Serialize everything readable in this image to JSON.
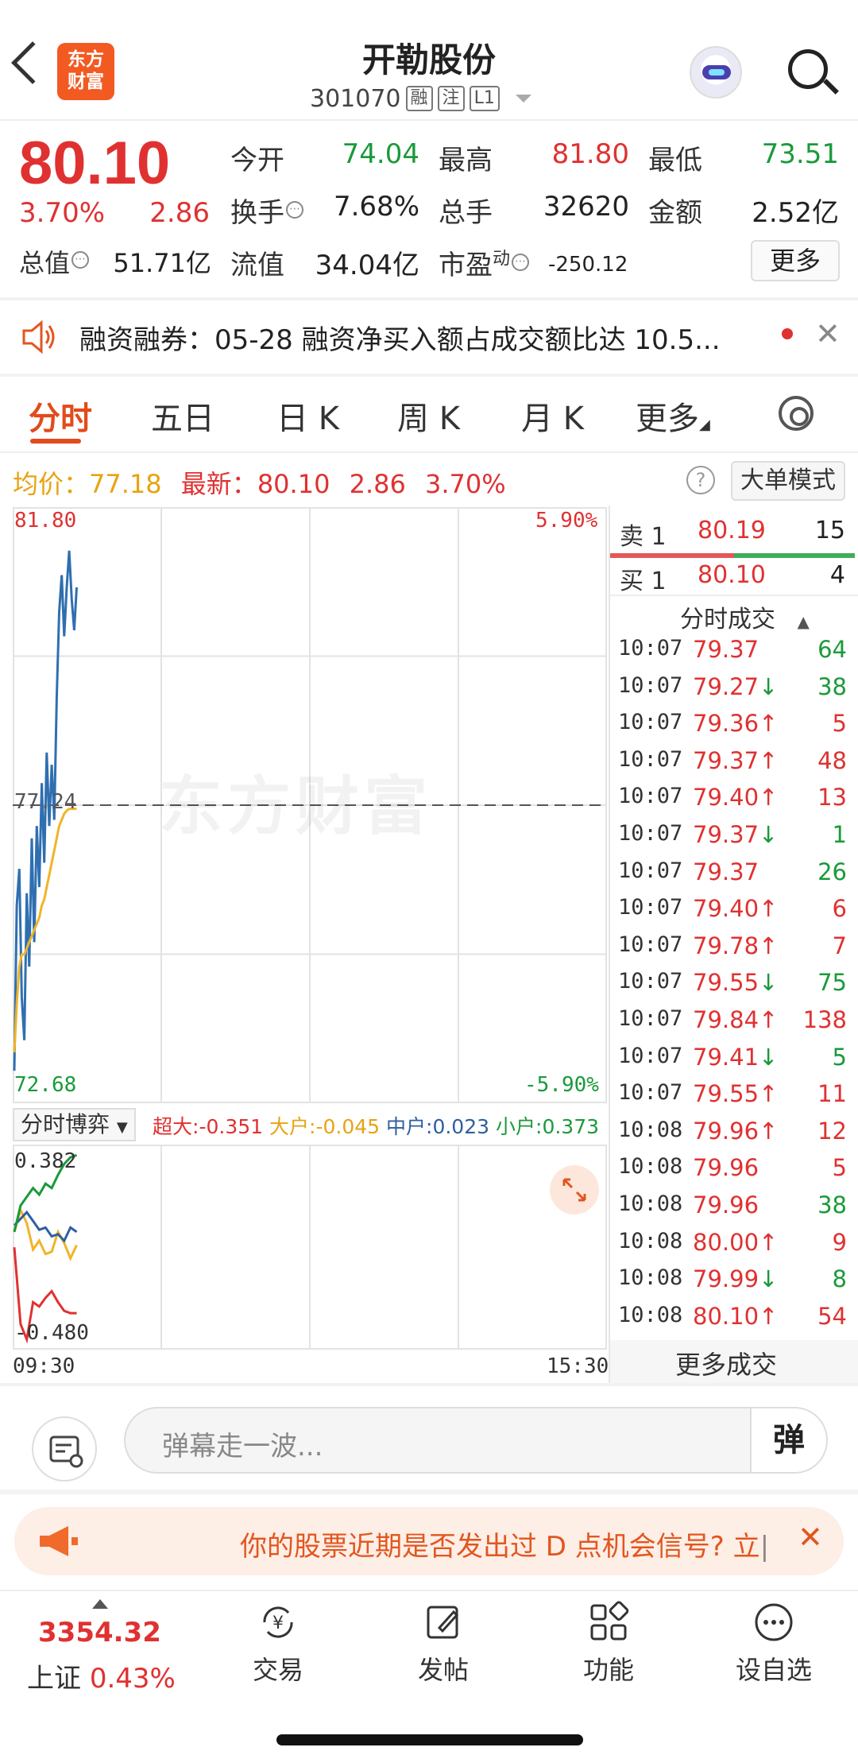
{
  "header": {
    "logo_line1": "东方",
    "logo_line2": "财富",
    "title": "开勒股份",
    "code": "301070",
    "tags": [
      "融",
      "注",
      "L1"
    ]
  },
  "quote": {
    "price": "80.10",
    "change_pct": "3.70%",
    "change": "2.86",
    "open_label": "今开",
    "open": "74.04",
    "high_label": "最高",
    "high": "81.80",
    "low_label": "最低",
    "low": "73.51",
    "turnover_label": "换手",
    "turnover": "7.68%",
    "volume_label": "总手",
    "volume": "32620",
    "amount_label": "金额",
    "amount": "2.52亿",
    "mktcap_label": "总值",
    "mktcap": "51.71亿",
    "float_label": "流值",
    "float": "34.04亿",
    "pe_label": "市盈",
    "pe_sup": "动",
    "pe": "-250.12",
    "more": "更多"
  },
  "notice": {
    "text": "融资融券：05-28 融资净买入额占成交额比达 10.5..."
  },
  "tabs": [
    "分时",
    "五日",
    "日 K",
    "周 K",
    "月 K",
    "更多"
  ],
  "info_row": {
    "avg_label": "均价：",
    "avg": "77.18",
    "latest_label": "最新：",
    "latest": "80.10",
    "change": "2.86",
    "change_pct": "3.70%",
    "help": "?",
    "big_order": "大单模式"
  },
  "chart_data": [
    {
      "type": "line",
      "x_start": "09:30",
      "x_end": "15:30",
      "ylim": [
        72.68,
        81.8
      ],
      "y_mid": "77.24",
      "right_top": "5.90%",
      "right_bottom": "-5.90%",
      "series": [
        {
          "name": "最新",
          "color": "#2f6fb0",
          "values": [
            72.9,
            75.6,
            76.2,
            74.1,
            73.4,
            75.8,
            74.6,
            76.7,
            75.0,
            76.9,
            75.9,
            77.6,
            76.3,
            78.1,
            76.9,
            77.9,
            77.0,
            79.0,
            80.4,
            81.0,
            80.0,
            80.8,
            81.4,
            80.6,
            80.1,
            80.8
          ]
        },
        {
          "name": "均价",
          "color": "#f0b429",
          "values": [
            73.2,
            74.0,
            74.6,
            74.8,
            74.8,
            74.9,
            75.0,
            75.1,
            75.2,
            75.3,
            75.4,
            75.6,
            75.7,
            75.9,
            76.1,
            76.3,
            76.5,
            76.7,
            76.9,
            77.0,
            77.1,
            77.15,
            77.18,
            77.18,
            77.18,
            77.18
          ]
        }
      ]
    },
    {
      "type": "line",
      "title": "分时博弈",
      "ylim": [
        -0.48,
        0.382
      ],
      "y_top": "0.382",
      "y_bottom": "-0.480",
      "legend": [
        {
          "name": "超大",
          "value": "-0.351",
          "color": "#e03131"
        },
        {
          "name": "大户",
          "value": "-0.045",
          "color": "#e8a312"
        },
        {
          "name": "中户",
          "value": "0.023",
          "color": "#2f5f9e"
        },
        {
          "name": "小户",
          "value": "0.373",
          "color": "#1a9a3a"
        }
      ],
      "series": [
        {
          "name": "超大",
          "color": "#e03131",
          "values": [
            -0.05,
            -0.4,
            -0.47,
            -0.3,
            -0.32,
            -0.28,
            -0.25,
            -0.3,
            -0.34,
            -0.35,
            -0.35
          ]
        },
        {
          "name": "大户",
          "color": "#f0b429",
          "values": [
            0.02,
            0.12,
            0.06,
            -0.06,
            -0.02,
            -0.08,
            -0.07,
            0.02,
            -0.03,
            -0.1,
            -0.04
          ]
        },
        {
          "name": "中户",
          "color": "#2f5f9e",
          "values": [
            0.05,
            0.08,
            0.11,
            0.07,
            0.03,
            0.04,
            0.0,
            0.01,
            -0.02,
            0.04,
            0.02
          ]
        },
        {
          "name": "小户",
          "color": "#1a9a3a",
          "values": [
            0.02,
            0.14,
            0.18,
            0.22,
            0.19,
            0.24,
            0.22,
            0.28,
            0.33,
            0.36,
            0.37
          ]
        }
      ]
    }
  ],
  "order_book": {
    "sell_label": "卖 1",
    "sell_price": "80.19",
    "sell_vol": "15",
    "buy_label": "买 1",
    "buy_price": "80.10",
    "buy_vol": "4",
    "trades_title": "分时成交",
    "trades": [
      {
        "time": "10:07",
        "price": "79.37",
        "arrow": "",
        "vol": "64",
        "dir": "green"
      },
      {
        "time": "10:07",
        "price": "79.27",
        "arrow": "↓",
        "vol": "38",
        "dir": "green"
      },
      {
        "time": "10:07",
        "price": "79.36",
        "arrow": "↑",
        "vol": "5",
        "dir": "red"
      },
      {
        "time": "10:07",
        "price": "79.37",
        "arrow": "↑",
        "vol": "48",
        "dir": "red"
      },
      {
        "time": "10:07",
        "price": "79.40",
        "arrow": "↑",
        "vol": "13",
        "dir": "red"
      },
      {
        "time": "10:07",
        "price": "79.37",
        "arrow": "↓",
        "vol": "1",
        "dir": "green"
      },
      {
        "time": "10:07",
        "price": "79.37",
        "arrow": "",
        "vol": "26",
        "dir": "green"
      },
      {
        "time": "10:07",
        "price": "79.40",
        "arrow": "↑",
        "vol": "6",
        "dir": "red"
      },
      {
        "time": "10:07",
        "price": "79.78",
        "arrow": "↑",
        "vol": "7",
        "dir": "red"
      },
      {
        "time": "10:07",
        "price": "79.55",
        "arrow": "↓",
        "vol": "75",
        "dir": "green"
      },
      {
        "time": "10:07",
        "price": "79.84",
        "arrow": "↑",
        "vol": "138",
        "dir": "red"
      },
      {
        "time": "10:07",
        "price": "79.41",
        "arrow": "↓",
        "vol": "5",
        "dir": "green"
      },
      {
        "time": "10:07",
        "price": "79.55",
        "arrow": "↑",
        "vol": "11",
        "dir": "red"
      },
      {
        "time": "10:08",
        "price": "79.96",
        "arrow": "↑",
        "vol": "12",
        "dir": "red"
      },
      {
        "time": "10:08",
        "price": "79.96",
        "arrow": "",
        "vol": "5",
        "dir": "red"
      },
      {
        "time": "10:08",
        "price": "79.96",
        "arrow": "",
        "vol": "38",
        "dir": "green"
      },
      {
        "time": "10:08",
        "price": "80.00",
        "arrow": "↑",
        "vol": "9",
        "dir": "red"
      },
      {
        "time": "10:08",
        "price": "79.99",
        "arrow": "↓",
        "vol": "8",
        "dir": "green"
      },
      {
        "time": "10:08",
        "price": "80.10",
        "arrow": "↑",
        "vol": "54",
        "dir": "red"
      }
    ],
    "more_trades": "更多成交"
  },
  "danmaku": {
    "placeholder": "弹幕走一波...",
    "button": "弹"
  },
  "banner": {
    "text": "你的股票近期是否发出过 D 点机会信号?",
    "tail": "立"
  },
  "bottom_nav": {
    "index_value": "3354.32",
    "index_name": "上证",
    "index_change": "0.43%",
    "items": [
      "交易",
      "发帖",
      "功能",
      "设自选"
    ]
  }
}
